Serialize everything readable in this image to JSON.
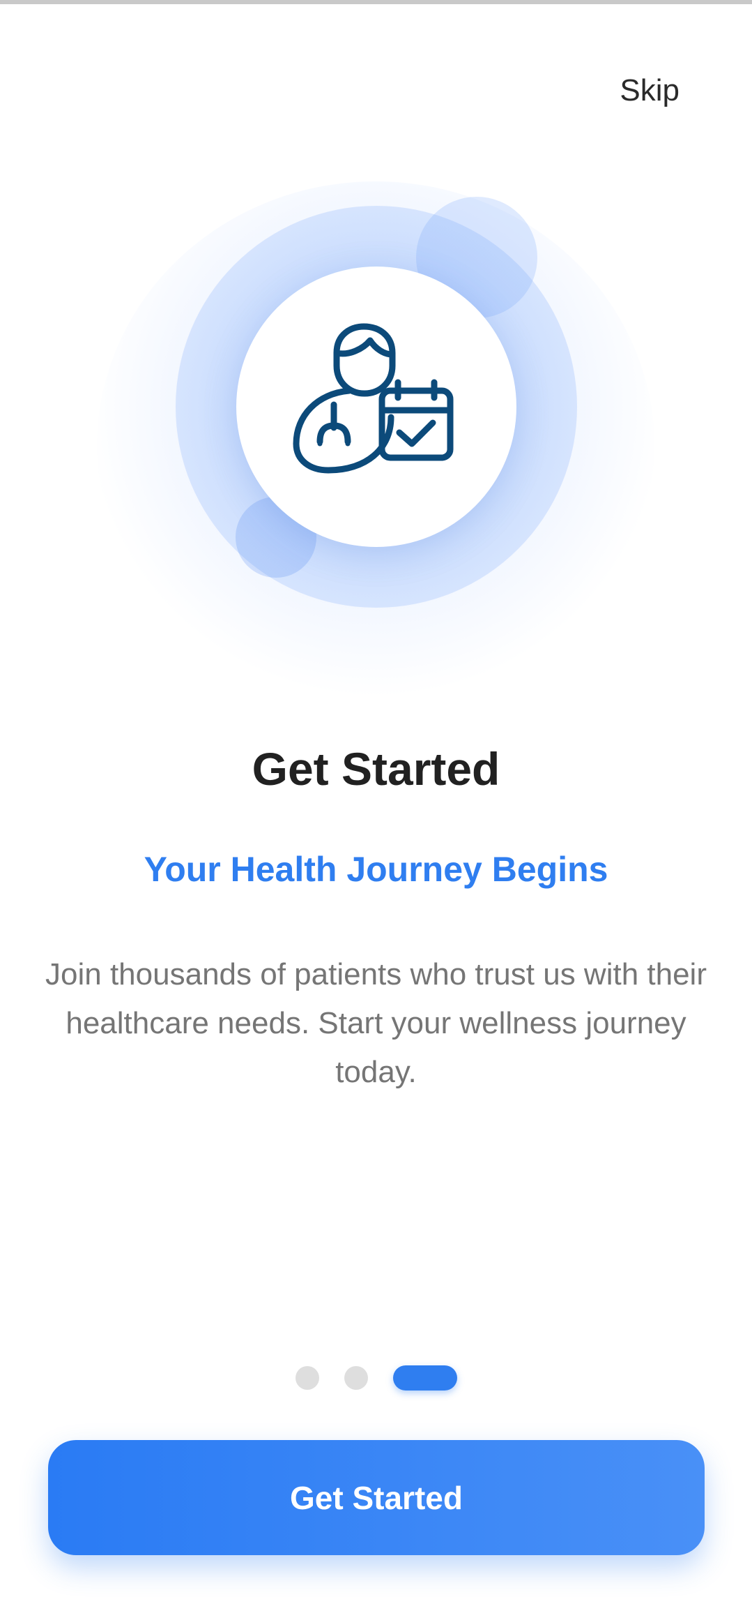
{
  "header": {
    "skip_label": "Skip"
  },
  "hero": {
    "icon": "doctor-calendar-icon",
    "icon_color": "#0c4a7a"
  },
  "content": {
    "title": "Get Started",
    "subtitle": "Your Health Journey Begins",
    "description": "Join thousands of patients who trust us with their healthcare needs. Start your wellness journey today."
  },
  "pagination": {
    "total": 3,
    "active_index": 3
  },
  "cta": {
    "label": "Get Started"
  },
  "colors": {
    "accent": "#2f7ef0",
    "title": "#212121",
    "body": "#757575"
  }
}
